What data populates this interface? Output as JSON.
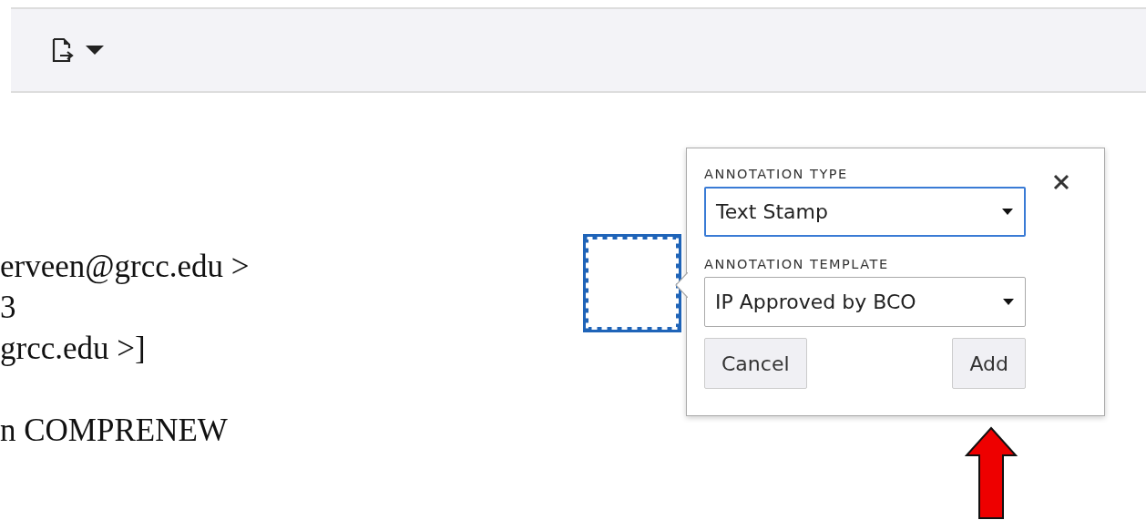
{
  "document": {
    "paragraphs": [
      [
        "erveen@grcc.edu >",
        "3",
        "grcc.edu >]"
      ],
      [
        "n COMPRENEW"
      ]
    ]
  },
  "annotation_popover": {
    "fields": [
      {
        "label": "ANNOTATION TYPE",
        "value": "Text Stamp",
        "focused": true
      },
      {
        "label": "ANNOTATION TEMPLATE",
        "value": "IP Approved by BCO",
        "focused": false
      }
    ],
    "buttons": [
      "Cancel",
      "Add"
    ]
  }
}
